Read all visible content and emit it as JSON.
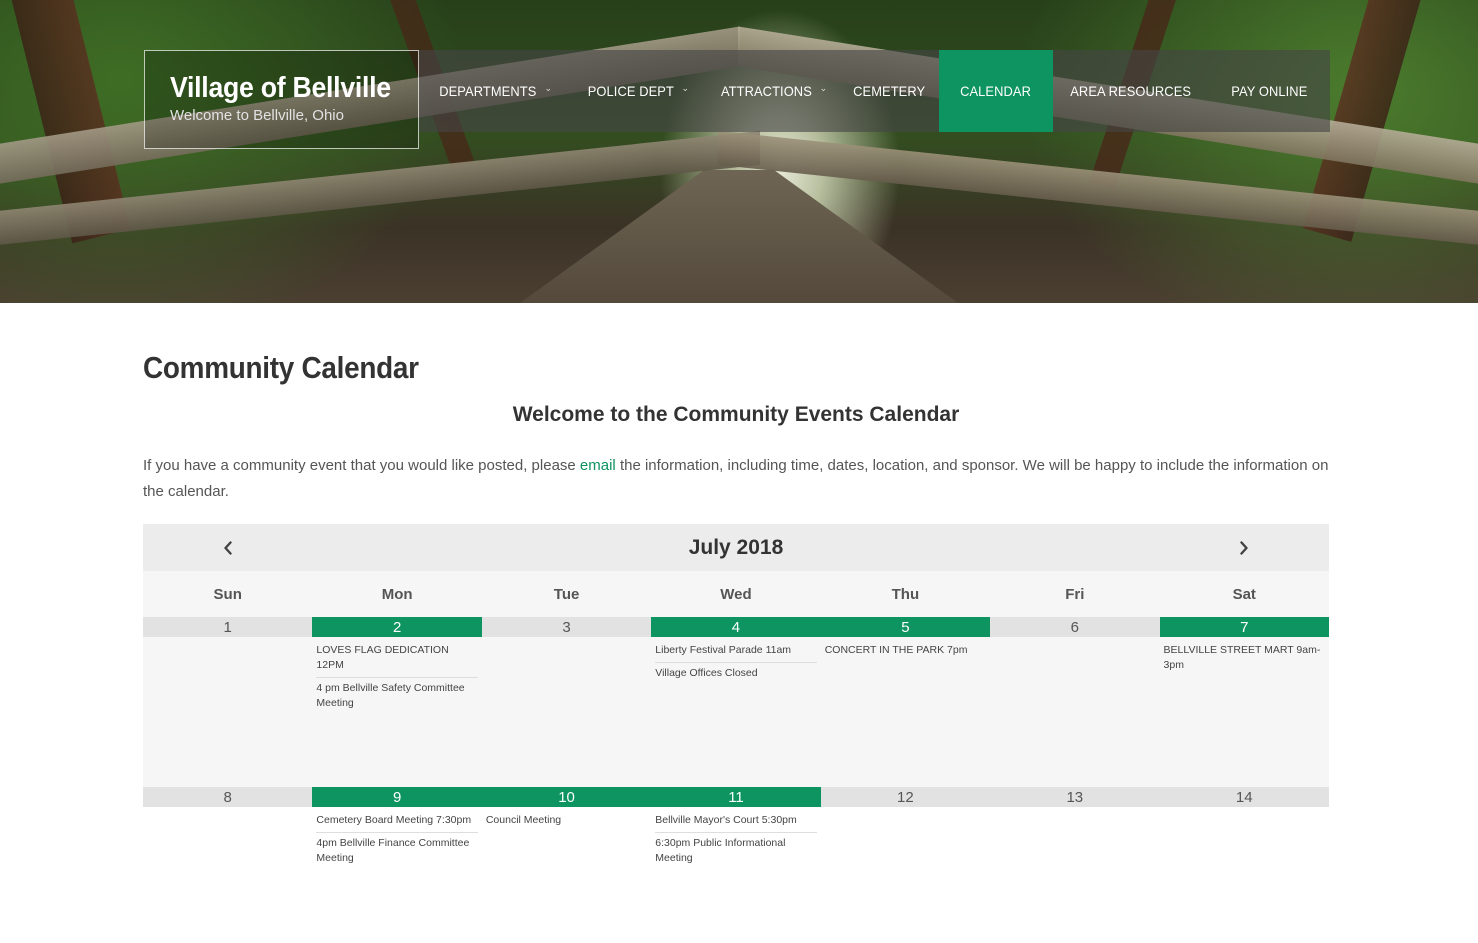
{
  "site": {
    "title": "Village of Bellville",
    "tagline": "Welcome to Bellville, Ohio"
  },
  "nav": [
    {
      "label": "DEPARTMENTS",
      "dropdown": true,
      "active": false
    },
    {
      "label": "POLICE DEPT",
      "dropdown": true,
      "active": false
    },
    {
      "label": "ATTRACTIONS",
      "dropdown": true,
      "active": false
    },
    {
      "label": "CEMETERY",
      "dropdown": false,
      "active": false
    },
    {
      "label": "CALENDAR",
      "dropdown": false,
      "active": true
    },
    {
      "label": "AREA RESOURCES",
      "dropdown": false,
      "active": false
    },
    {
      "label": "PAY ONLINE",
      "dropdown": false,
      "active": false
    }
  ],
  "page": {
    "title": "Community Calendar",
    "welcome": "Welcome to the Community Events Calendar",
    "intro_before": "If you have a community event that you would like posted, please ",
    "intro_link": "email",
    "intro_after": " the information, including time, dates, location, and sponsor. We will be happy to include the information on the calendar."
  },
  "calendar": {
    "month_label": "July 2018",
    "prev_icon": "chevron-left-icon",
    "next_icon": "chevron-right-icon",
    "weekdays": [
      "Sun",
      "Mon",
      "Tue",
      "Wed",
      "Thu",
      "Fri",
      "Sat"
    ],
    "weeks": [
      [
        {
          "day": "1",
          "events": []
        },
        {
          "day": "2",
          "events": [
            "LOVES FLAG DEDICATION 12PM",
            "4 pm Bellville Safety Committee Meeting"
          ]
        },
        {
          "day": "3",
          "events": []
        },
        {
          "day": "4",
          "events": [
            "Liberty Festival Parade 11am",
            "Village Offices Closed"
          ]
        },
        {
          "day": "5",
          "events": [
            "CONCERT IN THE PARK 7pm"
          ]
        },
        {
          "day": "6",
          "events": []
        },
        {
          "day": "7",
          "events": [
            "BELLVILLE STREET MART 9am-3pm"
          ]
        }
      ],
      [
        {
          "day": "8",
          "events": []
        },
        {
          "day": "9",
          "events": [
            "Cemetery Board Meeting 7:30pm",
            "4pm Bellville Finance Committee Meeting"
          ]
        },
        {
          "day": "10",
          "events": [
            "Council Meeting"
          ]
        },
        {
          "day": "11",
          "events": [
            "Bellville Mayor's Court 5:30pm",
            "6:30pm Public Informational Meeting"
          ]
        },
        {
          "day": "12",
          "events": []
        },
        {
          "day": "13",
          "events": []
        },
        {
          "day": "14",
          "events": []
        }
      ]
    ]
  },
  "colors": {
    "accent": "#0d9461",
    "day_header_empty": "#e2e2e2",
    "calendar_bg": "#f6f6f6"
  }
}
